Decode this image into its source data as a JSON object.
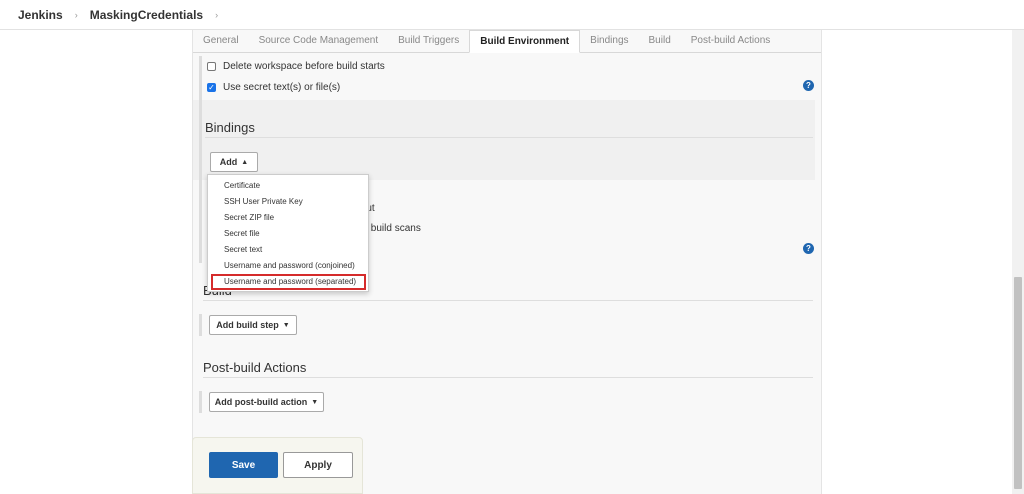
{
  "breadcrumb": {
    "items": [
      "Jenkins",
      "MaskingCredentials"
    ],
    "separator": "›"
  },
  "tabs": [
    "General",
    "Source Code Management",
    "Build Triggers",
    "Build Environment",
    "Bindings",
    "Build",
    "Post-build Actions"
  ],
  "active_tab": "Build Environment",
  "build_env": {
    "delete_workspace": "Delete workspace before build starts",
    "use_secret": "Use secret text(s) or file(s)",
    "help_icon": "?"
  },
  "bindings": {
    "heading": "Bindings",
    "add_button": "Add",
    "add_caret": "▲",
    "partial_labels": [
      "tput",
      "lle build scans"
    ]
  },
  "dropdown": {
    "items": [
      "Certificate",
      "SSH User Private Key",
      "Secret ZIP file",
      "Secret file",
      "Secret text",
      "Username and password (conjoined)",
      "Username and password (separated)"
    ],
    "highlighted": "Username and password (separated)"
  },
  "build": {
    "heading": "Build",
    "add_step_button": "Add build step",
    "caret": "▼"
  },
  "post_build": {
    "heading": "Post-build Actions",
    "add_action_button": "Add post-build action",
    "caret": "▼"
  },
  "footer": {
    "save_label": "Save",
    "apply_label": "Apply"
  },
  "colors": {
    "primary": "#1f66b0",
    "highlight_border": "#d52b2b"
  }
}
